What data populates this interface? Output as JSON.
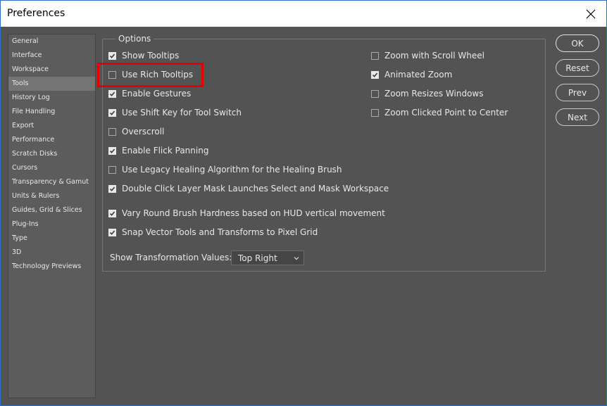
{
  "window": {
    "title": "Preferences"
  },
  "sidebar": {
    "items": [
      {
        "label": "General"
      },
      {
        "label": "Interface"
      },
      {
        "label": "Workspace"
      },
      {
        "label": "Tools",
        "active": true
      },
      {
        "label": "History Log"
      },
      {
        "label": "File Handling"
      },
      {
        "label": "Export"
      },
      {
        "label": "Performance"
      },
      {
        "label": "Scratch Disks"
      },
      {
        "label": "Cursors"
      },
      {
        "label": "Transparency & Gamut"
      },
      {
        "label": "Units & Rulers"
      },
      {
        "label": "Guides, Grid & Slices"
      },
      {
        "label": "Plug-Ins"
      },
      {
        "label": "Type"
      },
      {
        "label": "3D"
      },
      {
        "label": "Technology Previews"
      }
    ]
  },
  "options": {
    "group_label": "Options",
    "left": [
      {
        "label": "Show Tooltips",
        "checked": true
      },
      {
        "label": "Use Rich Tooltips",
        "checked": false
      },
      {
        "label": "Enable Gestures",
        "checked": true
      },
      {
        "label": "Use Shift Key for Tool Switch",
        "checked": true
      },
      {
        "label": "Overscroll",
        "checked": false
      },
      {
        "label": "Enable Flick Panning",
        "checked": true
      },
      {
        "label": "Use Legacy Healing Algorithm for the Healing Brush",
        "checked": false
      },
      {
        "label": "Double Click Layer Mask Launches Select and Mask Workspace",
        "checked": true
      },
      {
        "label": "Vary Round Brush Hardness based on HUD vertical movement",
        "checked": true
      },
      {
        "label": "Snap Vector Tools and Transforms to Pixel Grid",
        "checked": true
      }
    ],
    "right": [
      {
        "label": "Zoom with Scroll Wheel",
        "checked": false
      },
      {
        "label": "Animated Zoom",
        "checked": true
      },
      {
        "label": "Zoom Resizes Windows",
        "checked": false
      },
      {
        "label": "Zoom Clicked Point to Center",
        "checked": false
      }
    ],
    "transform": {
      "label": "Show Transformation Values:",
      "value": "Top Right"
    }
  },
  "buttons": {
    "ok": "OK",
    "reset": "Reset",
    "prev": "Prev",
    "next": "Next"
  },
  "colors": {
    "background": "#535353",
    "highlight": "#e80000",
    "accent_border": "#2d6fc4"
  }
}
